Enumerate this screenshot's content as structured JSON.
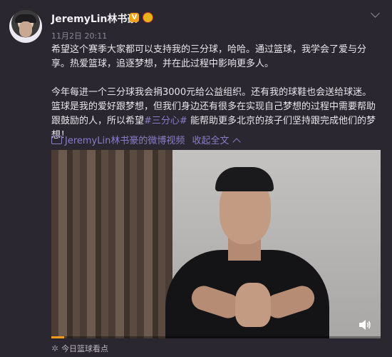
{
  "post": {
    "author": "JeremyLin林书豪",
    "verified_badge": "V",
    "timestamp": "11月2日 20:11",
    "paragraph1": "希望这个赛季大家都可以支持我的三分球，哈哈。通过篮球，我学会了爱与分享。热爱篮球，追逐梦想，并在此过程中影响更多人。",
    "paragraph2_part1": "今年每进一个三分球我会捐3000元给公益组织。还有我的球鞋也会送给球迷。篮球是我的爱好跟梦想，但我们身边还有很多在实现自己梦想的过程中需要帮助跟鼓励的人，所以希望",
    "hashtag": "#三分心#",
    "paragraph2_part2": " 能帮助更多北京的孩子们坚持跟完成他们的梦想！",
    "video_link": "JeremyLin林书豪的微博视频",
    "collapse_label": "收起全文",
    "footer_source": "今日篮球看点"
  },
  "icons": {
    "menu": "chevron-down-icon",
    "video": "video-icon",
    "volume": "volume-icon",
    "source": "star-icon"
  },
  "video": {
    "progress": 0.04
  },
  "colors": {
    "background": "#2b2730",
    "link": "#8a7cc9",
    "progress": "#f29a1a",
    "badge": "#f3a11a"
  }
}
